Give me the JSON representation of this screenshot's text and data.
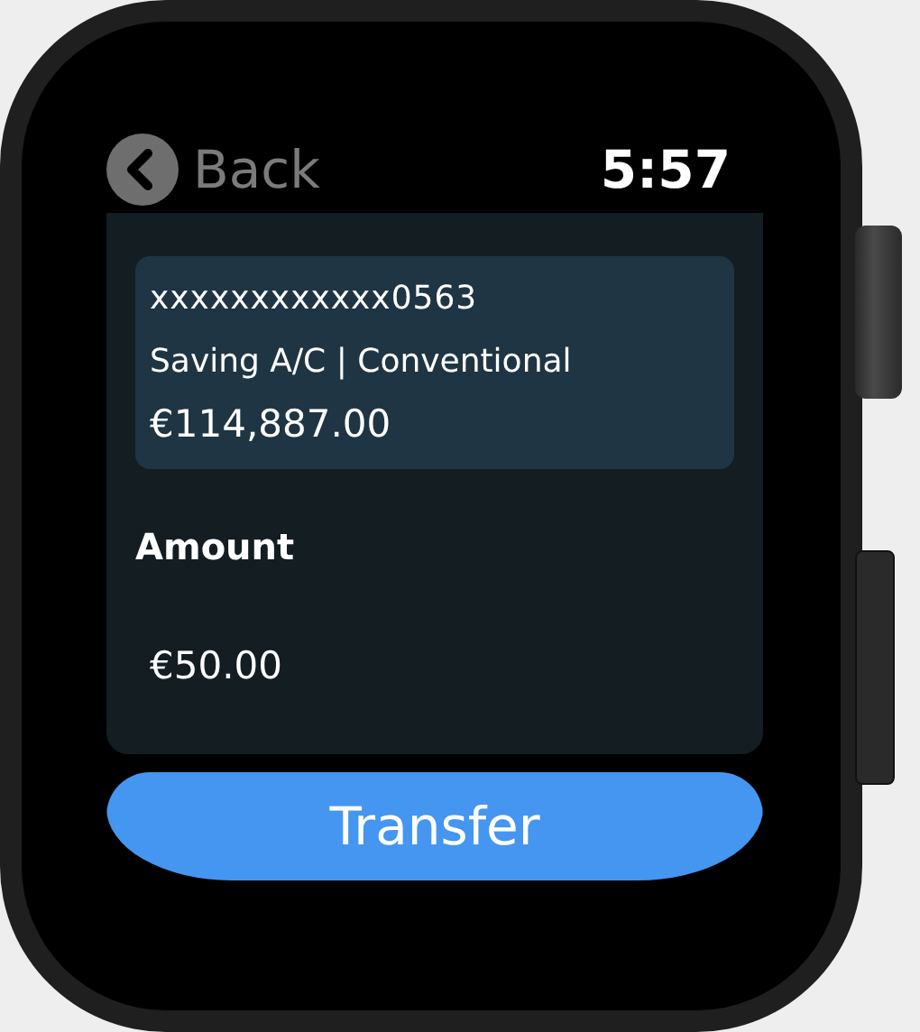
{
  "header": {
    "back_label": "Back",
    "time": "5:57"
  },
  "account": {
    "number": "xxxxxxxxxxxx0563",
    "type": "Saving A/C | Conventional",
    "balance": "€114,887.00"
  },
  "amount": {
    "label": "Amount",
    "value": "€50.00"
  },
  "primary_button": {
    "label": "Transfer"
  }
}
